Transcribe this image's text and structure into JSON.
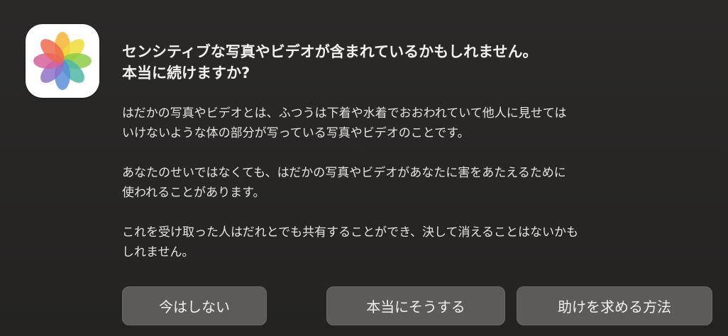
{
  "app_icon": "photos-app-icon",
  "title": {
    "line1": "センシティブな写真やビデオが含まれているかもしれません。",
    "line2": "本当に続けますか?"
  },
  "body": {
    "paragraphs": [
      {
        "line1": "はだかの写真やビデオとは、ふつうは下着や水着でおおわれていて他人に見せては",
        "line2": "いけないような体の部分が写っている写真やビデオのことです。"
      },
      {
        "line1": "あなたのせいではなくても、はだかの写真やビデオがあなたに害をあたえるために",
        "line2": "使われることがあります。"
      },
      {
        "line1": "これを受け取った人はだれとでも共有することができ、決して消えることはないかも",
        "line2": "しれません。"
      }
    ]
  },
  "buttons": {
    "not_now": "今はしない",
    "confirm": "本当にそうする",
    "help": "助けを求める方法"
  },
  "colors": {
    "background": "#262524",
    "button": "#5c5b59",
    "text": "#f2f0ee"
  }
}
